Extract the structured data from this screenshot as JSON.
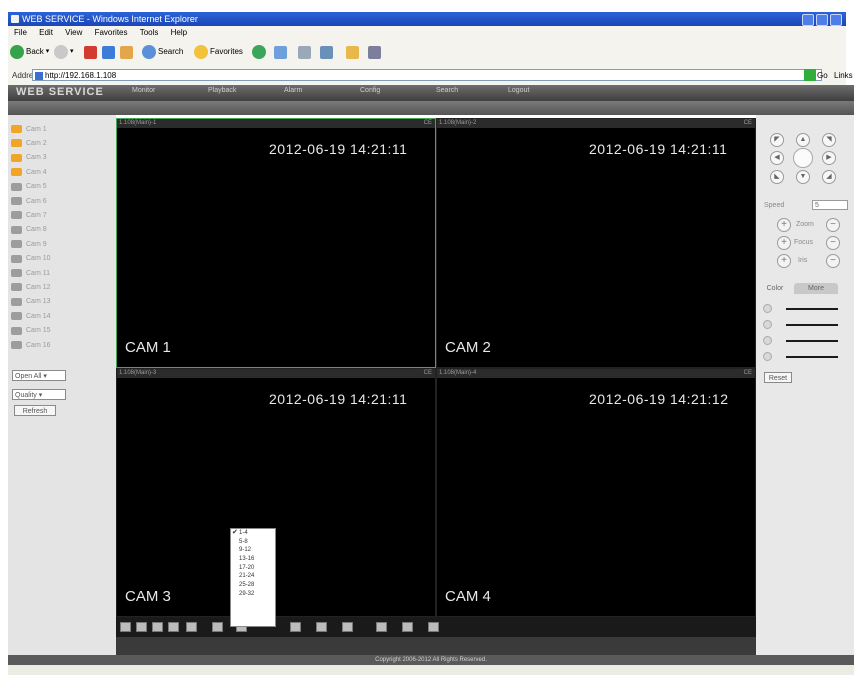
{
  "window": {
    "title": "WEB SERVICE - Windows Internet Explorer"
  },
  "menu": [
    "File",
    "Edit",
    "View",
    "Favorites",
    "Tools",
    "Help"
  ],
  "toolbar": {
    "back_label": "Back",
    "search_label": "Search",
    "favorites_label": "Favorites"
  },
  "address": {
    "label": "Address",
    "url": "http://192.168.1.108",
    "go_label": "Go",
    "links_label": "Links"
  },
  "app": {
    "logo": "WEB SERVICE",
    "tabs": [
      "Monitor",
      "Playback",
      "Alarm",
      "Config",
      "Search",
      "Logout"
    ]
  },
  "channels": [
    "Cam 1",
    "Cam 2",
    "Cam 3",
    "Cam 4",
    "Cam 5",
    "Cam 6",
    "Cam 7",
    "Cam 8",
    "Cam 9",
    "Cam 10",
    "Cam 11",
    "Cam 12",
    "Cam 13",
    "Cam 14",
    "Cam 15",
    "Cam 16"
  ],
  "channel_active_count": 4,
  "left_controls": {
    "open_all": "Open All",
    "quality": "Quality",
    "refresh": "Refresh"
  },
  "cameras": [
    {
      "name": "CAM 1",
      "timestamp": "2012-06-19 14:21:11",
      "bar_left": "1.108(Main)-1",
      "bar_right": "CE"
    },
    {
      "name": "CAM 2",
      "timestamp": "2012-06-19 14:21:11",
      "bar_left": "1.108(Main)-2",
      "bar_right": "CE"
    },
    {
      "name": "CAM 3",
      "timestamp": "2012-06-19 14:21:11",
      "bar_left": "1.108(Main)-3",
      "bar_right": "CE"
    },
    {
      "name": "CAM 4",
      "timestamp": "2012-06-19 14:21:12",
      "bar_left": "1.108(Main)-4",
      "bar_right": "CE"
    }
  ],
  "split_menu": {
    "items": [
      "1-4",
      "5-8",
      "9-12",
      "13-16",
      "17-20",
      "21-24",
      "25-28",
      "29-32"
    ],
    "selected": "1-4"
  },
  "ptz": {
    "speed_label": "Speed",
    "speed_value": "5",
    "zoom": "Zoom",
    "focus": "Focus",
    "iris": "Iris",
    "color_tab": "Color",
    "more_tab": "More",
    "reset": "Reset"
  },
  "footer": {
    "copyright": "Copyright 2006-2012 All Rights Reserved."
  },
  "colors": {
    "accent_active_border": "#4aa35a",
    "channel_on": "#f0a428"
  }
}
